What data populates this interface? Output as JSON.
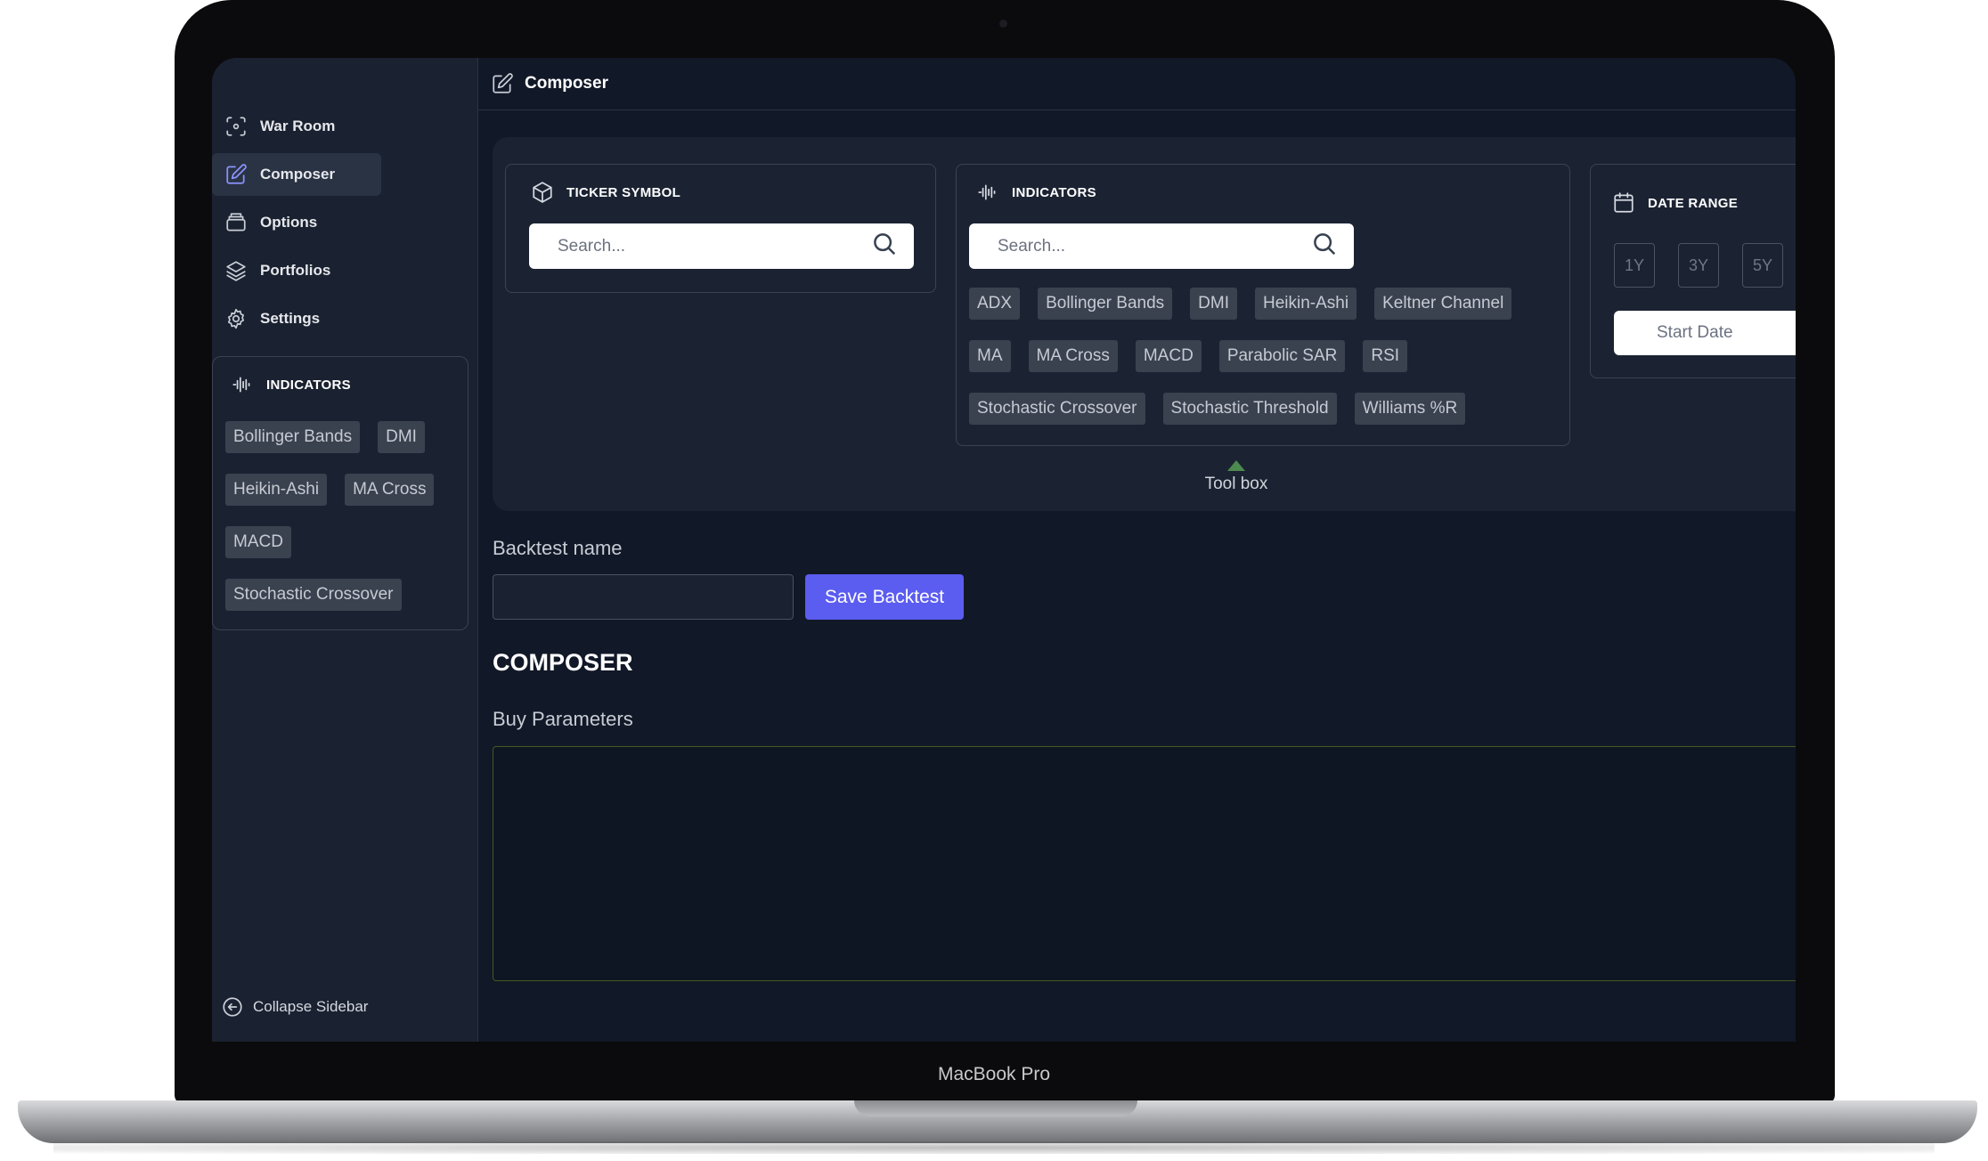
{
  "device": {
    "label": "MacBook Pro"
  },
  "sidebar": {
    "items": [
      {
        "label": "War Room",
        "icon": "focus-dashed-icon"
      },
      {
        "label": "Composer",
        "icon": "pencil-square-icon",
        "active": true
      },
      {
        "label": "Options",
        "icon": "stack-tray-icon"
      },
      {
        "label": "Portfolios",
        "icon": "layers-icon"
      },
      {
        "label": "Settings",
        "icon": "gear-icon"
      }
    ],
    "indicators_panel": {
      "title": "INDICATORS",
      "chips": [
        "Bollinger Bands",
        "DMI",
        "Heikin-Ashi",
        "MA Cross",
        "MACD",
        "Stochastic Crossover"
      ]
    },
    "collapse_label": "Collapse Sidebar"
  },
  "header": {
    "title": "Composer"
  },
  "toolbox": {
    "ticker": {
      "title": "TICKER SYMBOL",
      "placeholder": "Search..."
    },
    "indicators": {
      "title": "INDICATORS",
      "placeholder": "Search...",
      "chips": [
        "ADX",
        "Bollinger Bands",
        "DMI",
        "Heikin-Ashi",
        "Keltner Channel",
        "MA",
        "MA Cross",
        "MACD",
        "Parabolic SAR",
        "RSI",
        "Stochastic Crossover",
        "Stochastic Threshold",
        "Williams %R"
      ]
    },
    "date_range": {
      "title": "DATE RANGE",
      "presets": [
        "1Y",
        "3Y",
        "5Y"
      ],
      "start_placeholder": "Start Date"
    },
    "toggle_label": "Tool box"
  },
  "backtest": {
    "name_label": "Backtest name",
    "save_label": "Save Backtest"
  },
  "composer": {
    "title": "COMPOSER",
    "buy_params_label": "Buy Parameters"
  },
  "colors": {
    "accent": "#5b5cf0",
    "background": "#111827",
    "panel": "#1b2333"
  }
}
